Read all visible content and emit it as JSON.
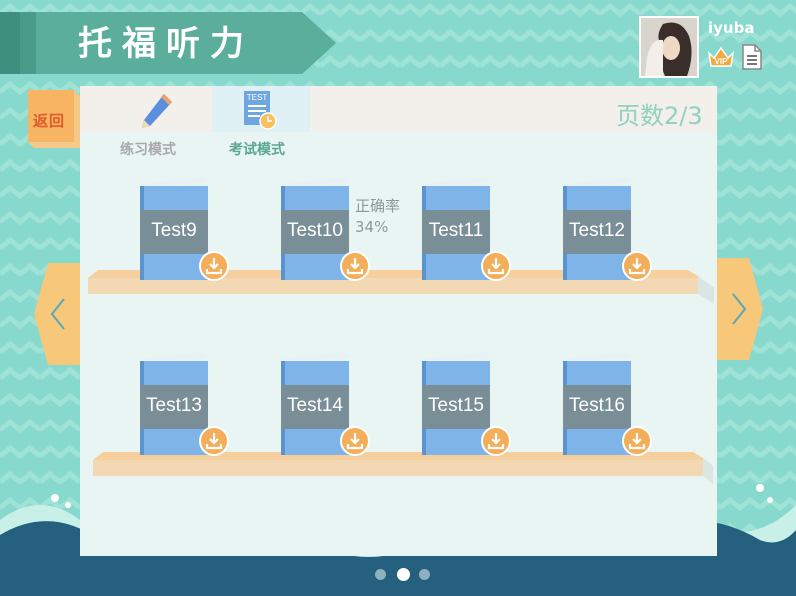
{
  "header": {
    "title": "托福听力",
    "username": "iyuba"
  },
  "nav": {
    "back_label": "返回"
  },
  "tabs": [
    {
      "label": "练习模式",
      "icon": "pencil-icon",
      "active": false
    },
    {
      "label": "考试模式",
      "icon": "test-paper-icon",
      "active": true
    }
  ],
  "page_indicator": "页数2/3",
  "books": [
    {
      "title": "Test9"
    },
    {
      "title": "Test10",
      "accuracy_label": "正确率",
      "accuracy_value": "34%"
    },
    {
      "title": "Test11"
    },
    {
      "title": "Test12"
    },
    {
      "title": "Test13"
    },
    {
      "title": "Test14"
    },
    {
      "title": "Test15"
    },
    {
      "title": "Test16"
    }
  ],
  "pager": {
    "count": 3,
    "active_index": 1
  },
  "colors": {
    "background": "#86d9cc",
    "banner": "#4fa896",
    "accent_orange": "#f7c77a",
    "book_blue": "#7fb4e8",
    "book_band": "#7a8e97",
    "wave_dark": "#25607e"
  }
}
